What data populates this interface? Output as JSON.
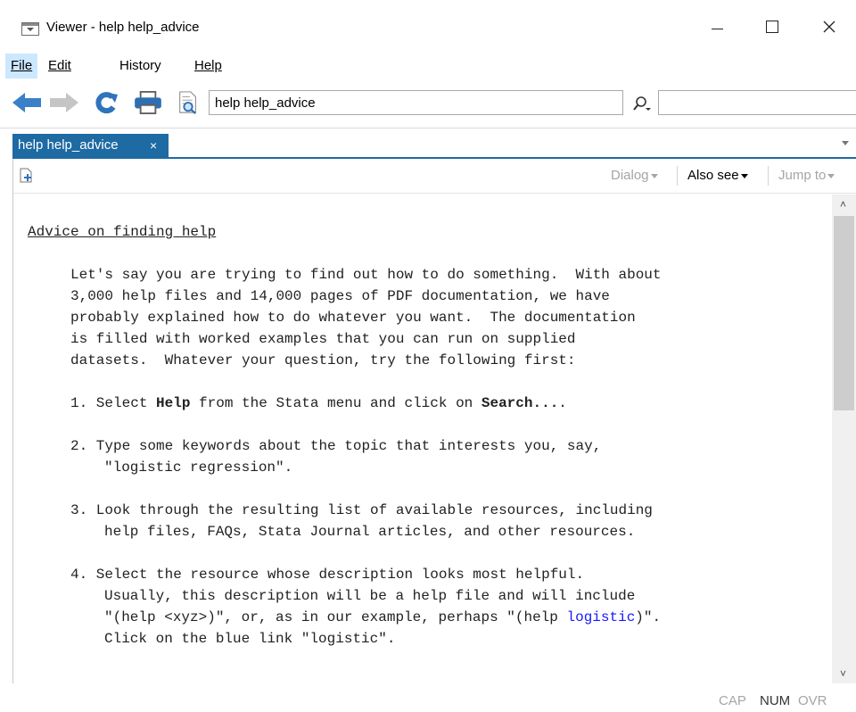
{
  "window": {
    "title": "Viewer - help help_advice"
  },
  "menu": {
    "file": "File",
    "edit": "Edit",
    "history": "History",
    "help": "Help"
  },
  "toolbar": {
    "address_value": "help help_advice",
    "search_value": ""
  },
  "tab": {
    "label": "help help_advice",
    "close": "×"
  },
  "viewer_toolbar": {
    "dialog": "Dialog",
    "also_see": "Also see",
    "jump_to": "Jump to"
  },
  "doc": {
    "heading": "Advice on finding help",
    "para": [
      "Let's say you are trying to find out how to do something.  With about",
      "3,000 help files and 14,000 pages of PDF documentation, we have",
      "probably explained how to do whatever you want.  The documentation",
      "is filled with worked examples that you can run on supplied",
      "datasets.  Whatever your question, try the following first:"
    ],
    "step1": {
      "pre": "1. Select ",
      "b1": "Help",
      "mid": " from the Stata menu and click on ",
      "b2": "Search...",
      "post": "."
    },
    "step2": [
      "2. Type some keywords about the topic that interests you, say,",
      "\"logistic regression\"."
    ],
    "step3": [
      "3. Look through the resulting list of available resources, including",
      "help files, FAQs, Stata Journal articles, and other resources."
    ],
    "step4": {
      "l1": "4. Select the resource whose description looks most helpful.",
      "l2": "Usually, this description will be a help file and will include",
      "l3_pre": "\"(help <xyz>)\", or, as in our example, perhaps \"(help ",
      "l3_link": "logistic",
      "l3_post": ")\".",
      "l4": "Click on the blue link \"logistic\"."
    }
  },
  "status": {
    "cap": "CAP",
    "num": "NUM",
    "ovr": "OVR"
  },
  "colors": {
    "tab": "#1e6aa3",
    "link": "#1a1aff",
    "menu_active": "#cce8ff"
  }
}
